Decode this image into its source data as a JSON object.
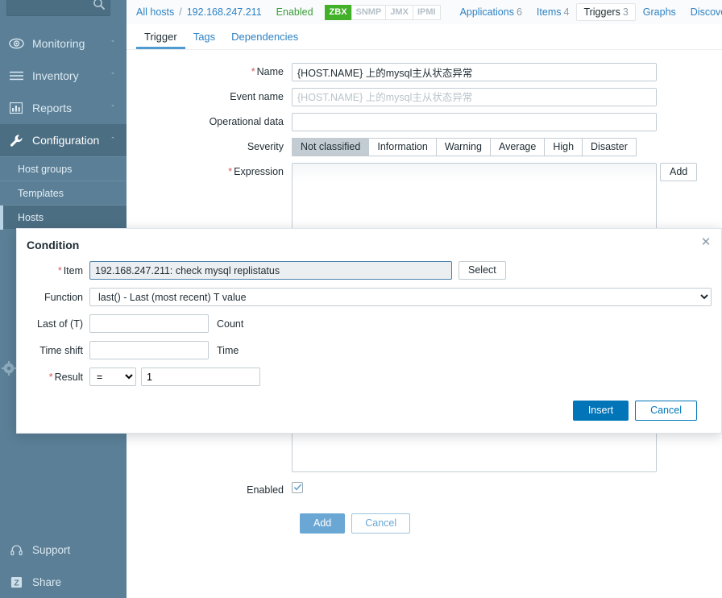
{
  "sidebar": {
    "search": {
      "value": "",
      "placeholder": "",
      "icon": "search-icon"
    },
    "items": [
      {
        "label": "Monitoring",
        "icon": "eye-icon",
        "chevron": "ˇ"
      },
      {
        "label": "Inventory",
        "icon": "list-icon",
        "chevron": "ˇ"
      },
      {
        "label": "Reports",
        "icon": "bar-chart-icon",
        "chevron": "ˇ"
      },
      {
        "label": "Configuration",
        "icon": "wrench-icon",
        "chevron": "ˆ"
      }
    ],
    "sub_items": [
      {
        "label": "Host groups"
      },
      {
        "label": "Templates"
      },
      {
        "label": "Hosts"
      }
    ],
    "bottom_items": [
      {
        "label": "Support",
        "icon": "headset-icon"
      },
      {
        "label": "Share",
        "icon": "zabbix-z-icon"
      }
    ],
    "gear_icon": "gear-icon"
  },
  "breadcrumb": {
    "all_hosts": "All hosts",
    "separator": "/",
    "host": "192.168.247.211",
    "status": "Enabled",
    "tags": [
      {
        "label": "ZBX",
        "active": true
      },
      {
        "label": "SNMP",
        "active": false
      },
      {
        "label": "JMX",
        "active": false
      },
      {
        "label": "IPMI",
        "active": false
      }
    ],
    "nav": [
      {
        "label": "Applications",
        "count": "6",
        "current": false
      },
      {
        "label": "Items",
        "count": "4",
        "current": false
      },
      {
        "label": "Triggers",
        "count": "3",
        "current": true
      },
      {
        "label": "Graphs",
        "count": "",
        "current": false
      },
      {
        "label": "Discovery r",
        "count": "",
        "current": false
      }
    ]
  },
  "tabs": [
    {
      "label": "Trigger",
      "active": true
    },
    {
      "label": "Tags",
      "active": false
    },
    {
      "label": "Dependencies",
      "active": false
    }
  ],
  "form": {
    "name_label": "Name",
    "name_value": "{HOST.NAME} 上的mysql主从状态异常",
    "event_name_label": "Event name",
    "event_name_placeholder": "{HOST.NAME} 上的mysql主从状态异常",
    "event_name_value": "",
    "operational_data_label": "Operational data",
    "operational_data_value": "",
    "severity_label": "Severity",
    "severity_options": [
      {
        "label": "Not classified",
        "selected": true
      },
      {
        "label": "Information",
        "selected": false
      },
      {
        "label": "Warning",
        "selected": false
      },
      {
        "label": "Average",
        "selected": false
      },
      {
        "label": "High",
        "selected": false
      },
      {
        "label": "Disaster",
        "selected": false
      }
    ],
    "expression_label": "Expression",
    "expression_value": "",
    "expression_add_label": "Add",
    "description_value": "",
    "enabled_label": "Enabled",
    "enabled_checked": true,
    "add_label": "Add",
    "cancel_label": "Cancel"
  },
  "modal": {
    "title": "Condition",
    "close_icon": "close-icon",
    "item_label": "Item",
    "item_value": "192.168.247.211: check mysql replistatus",
    "select_label": "Select",
    "function_label": "Function",
    "function_value": "last() - Last (most recent) T value",
    "last_of_label": "Last of (T)",
    "last_of_value": "",
    "last_of_unit": "Count",
    "time_shift_label": "Time shift",
    "time_shift_value": "",
    "time_shift_unit": "Time",
    "result_label": "Result",
    "result_operator": "=",
    "result_value": "1",
    "insert_label": "Insert",
    "cancel_label": "Cancel"
  },
  "colors": {
    "sidebar_bg": "#5b7f96",
    "sidebar_active": "#4c6e83",
    "accent_link": "#2e82c4",
    "primary_button": "#0275b8",
    "status_enabled": "#3a9e3a",
    "tag_active": "#43b02a",
    "required_star": "#d45959"
  }
}
